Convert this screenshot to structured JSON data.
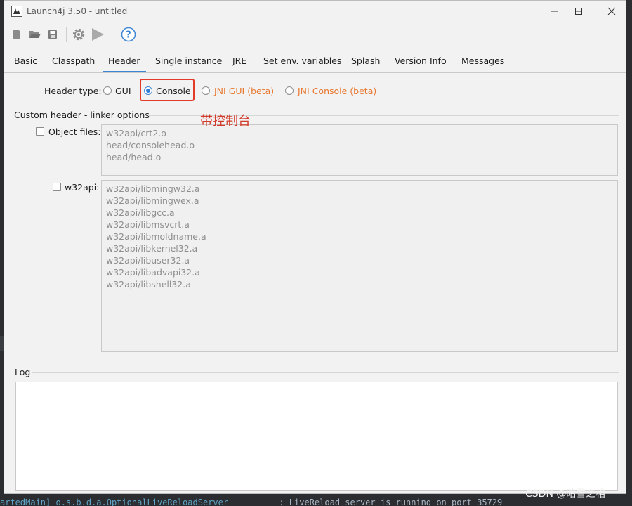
{
  "window": {
    "title": "Launch4j 3.50 - untitled"
  },
  "toolbar": {
    "buttons": [
      "new-icon",
      "open-icon",
      "save-icon",
      "settings-icon",
      "run-icon",
      "help-icon"
    ]
  },
  "tabs": [
    {
      "label": "Basic"
    },
    {
      "label": "Classpath"
    },
    {
      "label": "Header",
      "active": true
    },
    {
      "label": "Single instance"
    },
    {
      "label": "JRE"
    },
    {
      "label": "Set env. variables"
    },
    {
      "label": "Splash"
    },
    {
      "label": "Version Info"
    },
    {
      "label": "Messages"
    }
  ],
  "header_type": {
    "label": "Header type:",
    "options": [
      {
        "label": "GUI",
        "checked": false
      },
      {
        "label": "Console",
        "checked": true
      },
      {
        "label": "JNI GUI (beta)",
        "checked": false
      },
      {
        "label": "JNI Console (beta)",
        "checked": false
      }
    ]
  },
  "annotation": "带控制台",
  "custom_header": {
    "section_label": "Custom header - linker options",
    "object_files": {
      "label": "Object files:",
      "checked": false,
      "lines": [
        "w32api/crt2.o",
        "head/consolehead.o",
        "head/head.o"
      ]
    },
    "w32api": {
      "label": "w32api:",
      "checked": false,
      "lines": [
        "w32api/libmingw32.a",
        "w32api/libmingwex.a",
        "w32api/libgcc.a",
        "w32api/libmsvcrt.a",
        "w32api/libmoldname.a",
        "w32api/libkernel32.a",
        "w32api/libuser32.a",
        "w32api/libadvapi32.a",
        "w32api/libshell32.a"
      ]
    }
  },
  "log": {
    "label": "Log",
    "content": ""
  },
  "background_console": {
    "left": "artedMain] o.s.b.d.a.OptionalLiveReloadServer",
    "right": ": LiveReload server is running on port 35729"
  },
  "watermark": "CSDN @暗雪之格",
  "colors": {
    "accent": "#3d86d3",
    "highlight_box": "#e23b2a",
    "beta_option_text": "#e8772e"
  }
}
